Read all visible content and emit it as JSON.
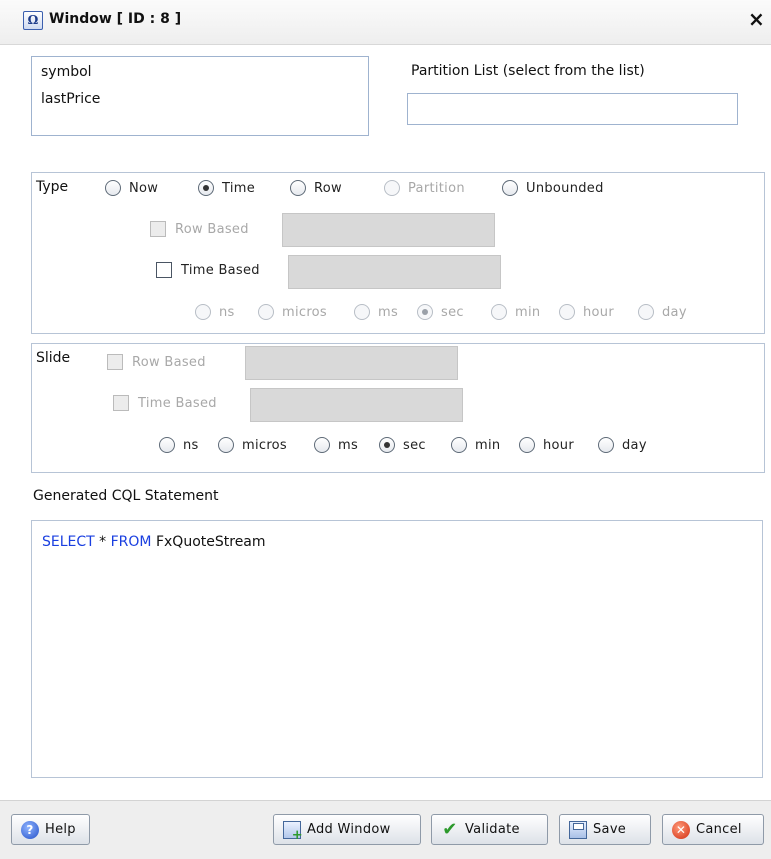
{
  "window": {
    "icon": "omega-icon",
    "title": "Window [ ID : 8 ]",
    "close": "×"
  },
  "fields": [
    "symbol",
    "lastPrice"
  ],
  "partition": {
    "label": "Partition List (select from the list)",
    "value": ""
  },
  "type_group": {
    "legend": "Type",
    "options": [
      {
        "label": "Now",
        "selected": false,
        "enabled": true
      },
      {
        "label": "Time",
        "selected": true,
        "enabled": true
      },
      {
        "label": "Row",
        "selected": false,
        "enabled": true
      },
      {
        "label": "Partition",
        "selected": false,
        "enabled": false
      },
      {
        "label": "Unbounded",
        "selected": false,
        "enabled": true
      }
    ],
    "row_based": {
      "label": "Row Based",
      "checked": false,
      "enabled": false
    },
    "time_based": {
      "label": "Time Based",
      "checked": false,
      "enabled": true
    },
    "units": [
      {
        "label": "ns",
        "selected": false
      },
      {
        "label": "micros",
        "selected": false
      },
      {
        "label": "ms",
        "selected": false
      },
      {
        "label": "sec",
        "selected": true
      },
      {
        "label": "min",
        "selected": false
      },
      {
        "label": "hour",
        "selected": false
      },
      {
        "label": "day",
        "selected": false
      }
    ]
  },
  "slide_group": {
    "legend": "Slide",
    "row_based": {
      "label": "Row Based",
      "checked": false,
      "enabled": false
    },
    "time_based": {
      "label": "Time Based",
      "checked": false,
      "enabled": false
    },
    "units": [
      {
        "label": "ns",
        "selected": false
      },
      {
        "label": "micros",
        "selected": false
      },
      {
        "label": "ms",
        "selected": false
      },
      {
        "label": "sec",
        "selected": true
      },
      {
        "label": "min",
        "selected": false
      },
      {
        "label": "hour",
        "selected": false
      },
      {
        "label": "day",
        "selected": false
      }
    ]
  },
  "cql": {
    "label": "Generated CQL Statement",
    "kw1": "SELECT",
    "star": " * ",
    "kw2": "FROM",
    "rest": " FxQuoteStream"
  },
  "buttons": {
    "help": {
      "label": "Help",
      "icon": "help-icon"
    },
    "add_window": {
      "label": "Add Window",
      "icon": "add-window-icon"
    },
    "validate": {
      "label": "Validate",
      "icon": "checkmark-icon"
    },
    "save": {
      "label": "Save",
      "icon": "save-icon"
    },
    "cancel": {
      "label": "Cancel",
      "icon": "cancel-icon"
    }
  }
}
